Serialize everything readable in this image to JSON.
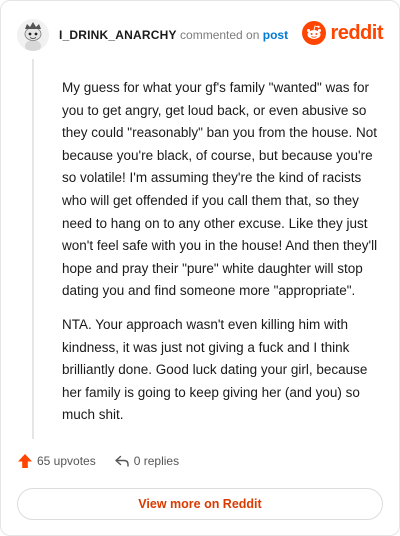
{
  "comment": {
    "username": "I_DRINK_ANARCHY",
    "action_text": "commented on",
    "post_link": "post"
  },
  "brand": {
    "word": "reddit",
    "icon": "reddit-snoo-icon",
    "color": "#ff4500"
  },
  "body": {
    "paragraphs": [
      "My guess for what your gf's family \"wanted\" was for you to get angry, get loud back, or even abusive so they could \"reasonably\" ban you from the house. Not because you're black, of course, but because you're so volatile! I'm assuming they're the kind of racists who will get offended if you call them that, so they need to hang on to any other excuse. Like they just won't feel safe with you in the house! And then they'll hope and pray their \"pure\" white daughter will stop dating you and find someone more \"appropriate\".",
      "NTA. Your approach wasn't even killing him with kindness, it was just not giving a fuck and I think brilliantly done. Good luck dating your girl, because her family is going to keep giving her (and you) so much shit."
    ]
  },
  "footer": {
    "upvotes_label": "65 upvotes",
    "upvote_icon": "upvote-arrow-icon",
    "replies_label": "0 replies",
    "reply_icon": "reply-icon",
    "accent": "#ff4500"
  },
  "cta": {
    "label": "View more on Reddit"
  }
}
